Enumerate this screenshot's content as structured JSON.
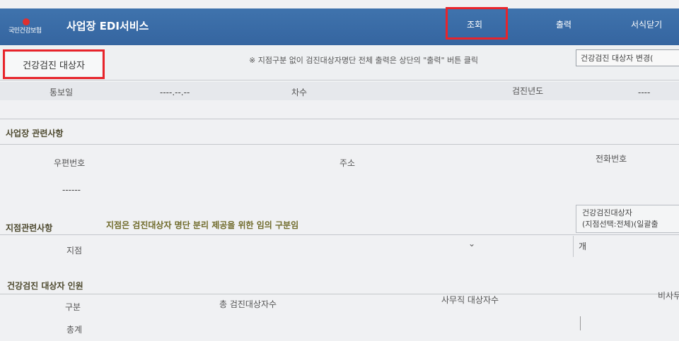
{
  "header": {
    "logo_text": "국민건강보험",
    "service_title": "사업장 EDI서비스",
    "nav": {
      "query_label": "조회",
      "print_label": "출력",
      "close_label": "서식닫기"
    }
  },
  "subheader": {
    "active_tab": "건강검진 대상자",
    "notice": "※ 지점구분 없이 검진대상자명단 전체 출력은 상단의 \"출력\" 버튼 클릭",
    "change_button": "건강검진 대상자 변경(",
    "change_button_suffix": "("
  },
  "info_row": {
    "notice_date_label": "통보일",
    "notice_date_value": "----.--.--",
    "count_label": "차수",
    "exam_year_label": "검진년도",
    "exam_year_value": "----"
  },
  "workplace": {
    "section_title": "사업장 관련사항",
    "zip_label": "우편번호",
    "address_label": "주소",
    "phone_label": "전화번호",
    "zip_value": "------"
  },
  "branch": {
    "section_title": "지점관련사항",
    "description": "지점은 검진대상자 명단 분리 제공을 위한 임의 구분임",
    "branch_label": "지점",
    "count_unit": "개",
    "right_box_line1": "건강검진대상자",
    "right_box_line2": "(지점선택:전체)(일괄출"
  },
  "persons": {
    "section_title": "건강검진 대상자 인원",
    "category_label": "구분",
    "total_label": "총 검진대상자수",
    "office_label": "사무직 대상자수",
    "non_office_label": "비사무",
    "sum_label": "총계"
  },
  "colors": {
    "header_blue": "#3a6ba6",
    "highlight_red": "#e8242b",
    "section_olive": "#6f6a2a"
  }
}
